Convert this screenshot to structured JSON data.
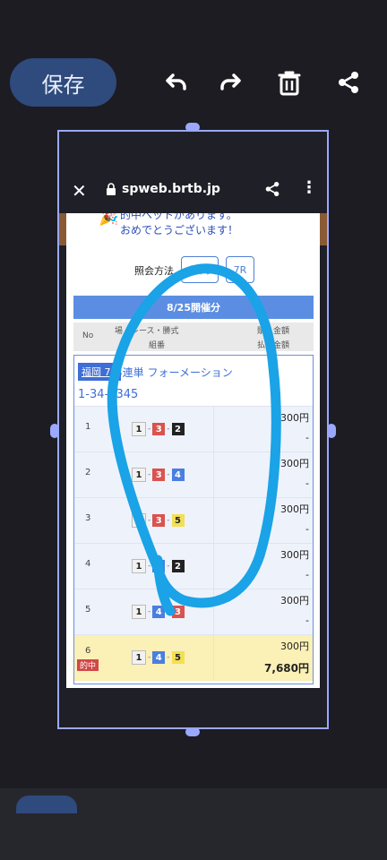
{
  "toolbar": {
    "save_label": "保存",
    "undo_icon": "undo-icon",
    "redo_icon": "redo-icon",
    "delete_icon": "trash-icon",
    "share_icon": "share-icon"
  },
  "browser": {
    "url": "spweb.brtb.jp"
  },
  "page": {
    "congrats_line1": "的中ベットがあります。",
    "congrats_line2": "おめでとうございます！",
    "lookup_label": "照会方法",
    "lookup_btn1": "福岡",
    "lookup_btn2": "7R",
    "date_header": "8/25開催分",
    "col_no": "No",
    "col_place": "場・レース・勝式",
    "col_purchase": "購入金額",
    "col_combo": "組番",
    "col_payout": "払戻金額",
    "race_tag": "福岡 7R",
    "race_title": "3連単 フォーメーション",
    "combo_title": "1-34-2345",
    "rows": [
      {
        "no": "1",
        "a": "1",
        "b": "3",
        "c": "2",
        "amount": "300円",
        "payout": "-",
        "hit": ""
      },
      {
        "no": "2",
        "a": "1",
        "b": "3",
        "c": "4",
        "amount": "300円",
        "payout": "-",
        "hit": ""
      },
      {
        "no": "3",
        "a": "1",
        "b": "3",
        "c": "5",
        "amount": "300円",
        "payout": "-",
        "hit": ""
      },
      {
        "no": "4",
        "a": "1",
        "b": "4",
        "c": "2",
        "amount": "300円",
        "payout": "-",
        "hit": ""
      },
      {
        "no": "5",
        "a": "1",
        "b": "4",
        "c": "3",
        "amount": "300円",
        "payout": "-",
        "hit": ""
      },
      {
        "no": "6",
        "a": "1",
        "b": "4",
        "c": "5",
        "amount": "300円",
        "payout": "7,680円",
        "hit": "的中"
      }
    ]
  },
  "colors": {
    "boat1": "#f2f2f2",
    "boat2": "#222222",
    "boat3": "#d9534f",
    "boat4": "#4a7fe0",
    "boat5": "#f3df55",
    "annotation": "#1aa3e6"
  }
}
